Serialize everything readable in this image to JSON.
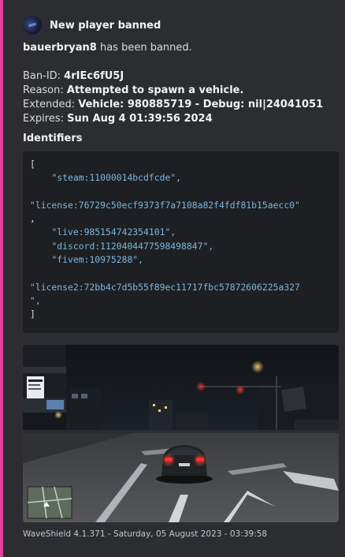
{
  "embed": {
    "accent_color": "#e0409b",
    "author": {
      "name": "New player banned",
      "icon": "waveshield-logo-icon"
    },
    "description": {
      "player": "bauerbryan8",
      "banned_text": " has been banned.",
      "ban_id_label": "Ban-ID: ",
      "ban_id": "4rIEc6fU5J",
      "reason_label": "Reason: ",
      "reason": "Attempted to spawn a vehicle.",
      "extended_label": "Extended: ",
      "extended": "Vehicle: 980885719 - Debug: nil|24041051",
      "expires_label": "Expires: ",
      "expires": "Sun Aug 4 01:39:56 2024"
    },
    "field": {
      "name": "Identifiers",
      "open_bracket": "[",
      "close_bracket": "]",
      "identifiers": [
        "\"steam:11000014bcdfcde\",",
        "\"license:76729c50ecf9373f7a7108a82f4fdf81b15aecc0\"",
        ",",
        "\"live:985154742354101\",",
        "\"discord:1120404477598498847\",",
        "\"fivem:10975288\",",
        "\"license2:72bb4c7d5b55f89ec11717fbc57872606225a327",
        "\","
      ]
    },
    "image": {
      "description": "game-screenshot"
    },
    "footer": "WaveShield 4.1.371 - Saturday, 05 August 2023 - 03:39:58"
  }
}
